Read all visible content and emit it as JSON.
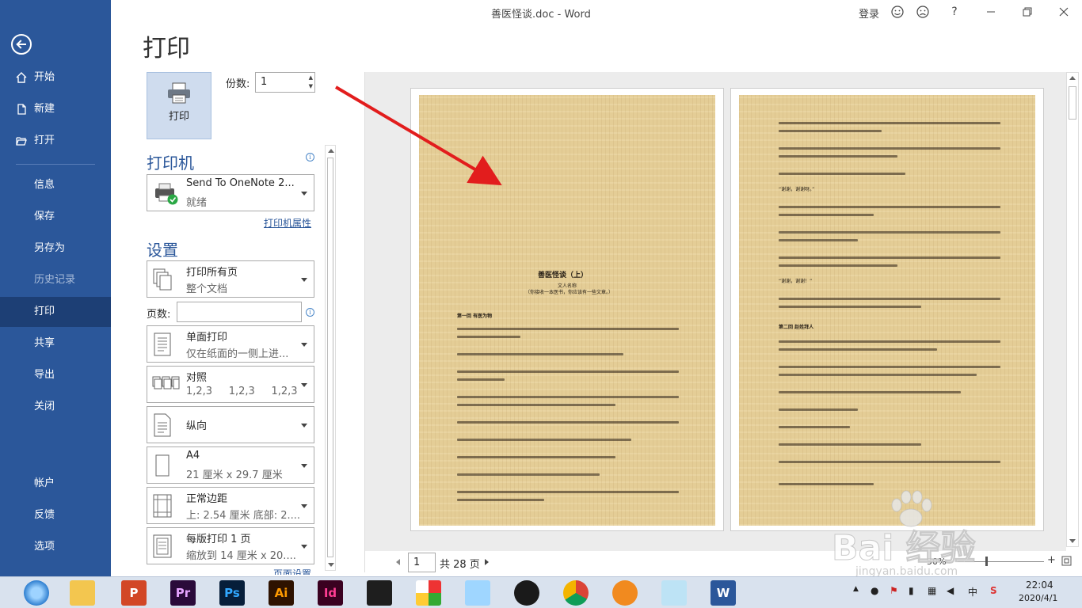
{
  "window": {
    "title": "善医怪谈.doc  -  Word",
    "login": "登录",
    "help": "?"
  },
  "sidebar": {
    "items": [
      {
        "label": "开始",
        "icon": "home-icon"
      },
      {
        "label": "新建",
        "icon": "new-document-icon"
      },
      {
        "label": "打开",
        "icon": "folder-open-icon"
      },
      {
        "label": "信息"
      },
      {
        "label": "保存"
      },
      {
        "label": "另存为"
      },
      {
        "label": "历史记录",
        "disabled": true
      },
      {
        "label": "打印",
        "active": true
      },
      {
        "label": "共享"
      },
      {
        "label": "导出"
      },
      {
        "label": "关闭"
      },
      {
        "label": "帐户"
      },
      {
        "label": "反馈"
      },
      {
        "label": "选项"
      }
    ]
  },
  "page_title": "打印",
  "print_button": {
    "label": "打印"
  },
  "copies": {
    "label": "份数:",
    "value": "1"
  },
  "printer": {
    "heading": "打印机",
    "name": "Send To OneNote 2...",
    "status": "就绪",
    "properties_link": "打印机属性"
  },
  "settings": {
    "heading": "设置",
    "pages_label": "页数:",
    "pages_value": "",
    "options": [
      {
        "main": "打印所有页",
        "sub": "整个文档"
      },
      {
        "main": "单面打印",
        "sub": "仅在纸面的一侧上进..."
      },
      {
        "main": "对照",
        "sub": "1,2,3     1,2,3     1,2,3"
      },
      {
        "main": "纵向",
        "sub": ""
      },
      {
        "main": "A4",
        "sub": "21 厘米 x 29.7 厘米"
      },
      {
        "main": "正常边距",
        "sub": "上: 2.54 厘米 底部: 2...."
      },
      {
        "main": "每版打印 1 页",
        "sub": "缩放到 14 厘米 x 20...."
      }
    ],
    "page_setup_link": "页面设置"
  },
  "preview": {
    "page1": {
      "title": "善医怪谈（上）",
      "author": "文人名称",
      "note": "（你接收一本医书，你应该有一些文章。）",
      "chapter": "第一回  有医为物"
    },
    "page2": {
      "chapter": "第二回  赵姓拜人",
      "quote1": "“谢谢，谢谢呀。”",
      "quote2": "“谢谢，谢谢！”"
    }
  },
  "page_nav": {
    "current": "1",
    "total": "共 28 页"
  },
  "zoom": {
    "level": "50%"
  },
  "watermark": {
    "brand": "Bai 经验",
    "url": "jingyan.baidu.com"
  },
  "taskbar": {
    "apps": [
      "browser",
      "file-explorer",
      "powerpoint",
      "premiere",
      "photoshop",
      "illustrator",
      "indesign",
      "video-editor",
      "umbrella-app",
      "qq-cat",
      "qq",
      "chrome",
      "fox-app",
      "notes",
      "word"
    ],
    "ime": "中",
    "time": "22:04",
    "date": "2020/4/1"
  }
}
